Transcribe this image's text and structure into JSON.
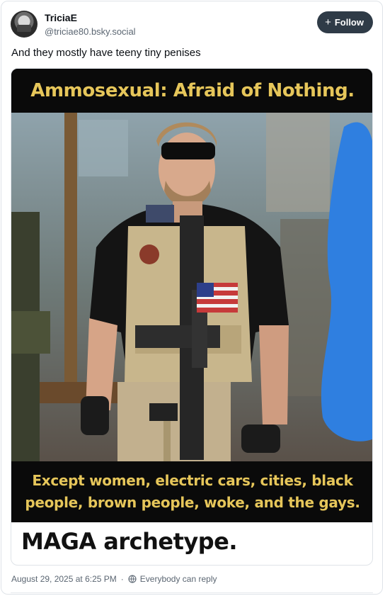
{
  "author": {
    "name": "TriciaE",
    "handle": "@triciae80.bsky.social",
    "follow_label": "Follow"
  },
  "post": {
    "text": "And they mostly have teeny tiny penises"
  },
  "embed": {
    "meme_top_text": "Ammosexual: Afraid of Nothing.",
    "meme_bottom_line1": "Except women, electric cars, cities, black",
    "meme_bottom_line2": "people, brown people, woke, and the gays.",
    "caption": "MAGA archetype."
  },
  "footer": {
    "timestamp": "August 29, 2025 at 6:25 PM",
    "reply_setting": "Everybody can reply"
  },
  "colors": {
    "meme_text": "#e6c65a",
    "follow_bg": "#2f3b47"
  }
}
